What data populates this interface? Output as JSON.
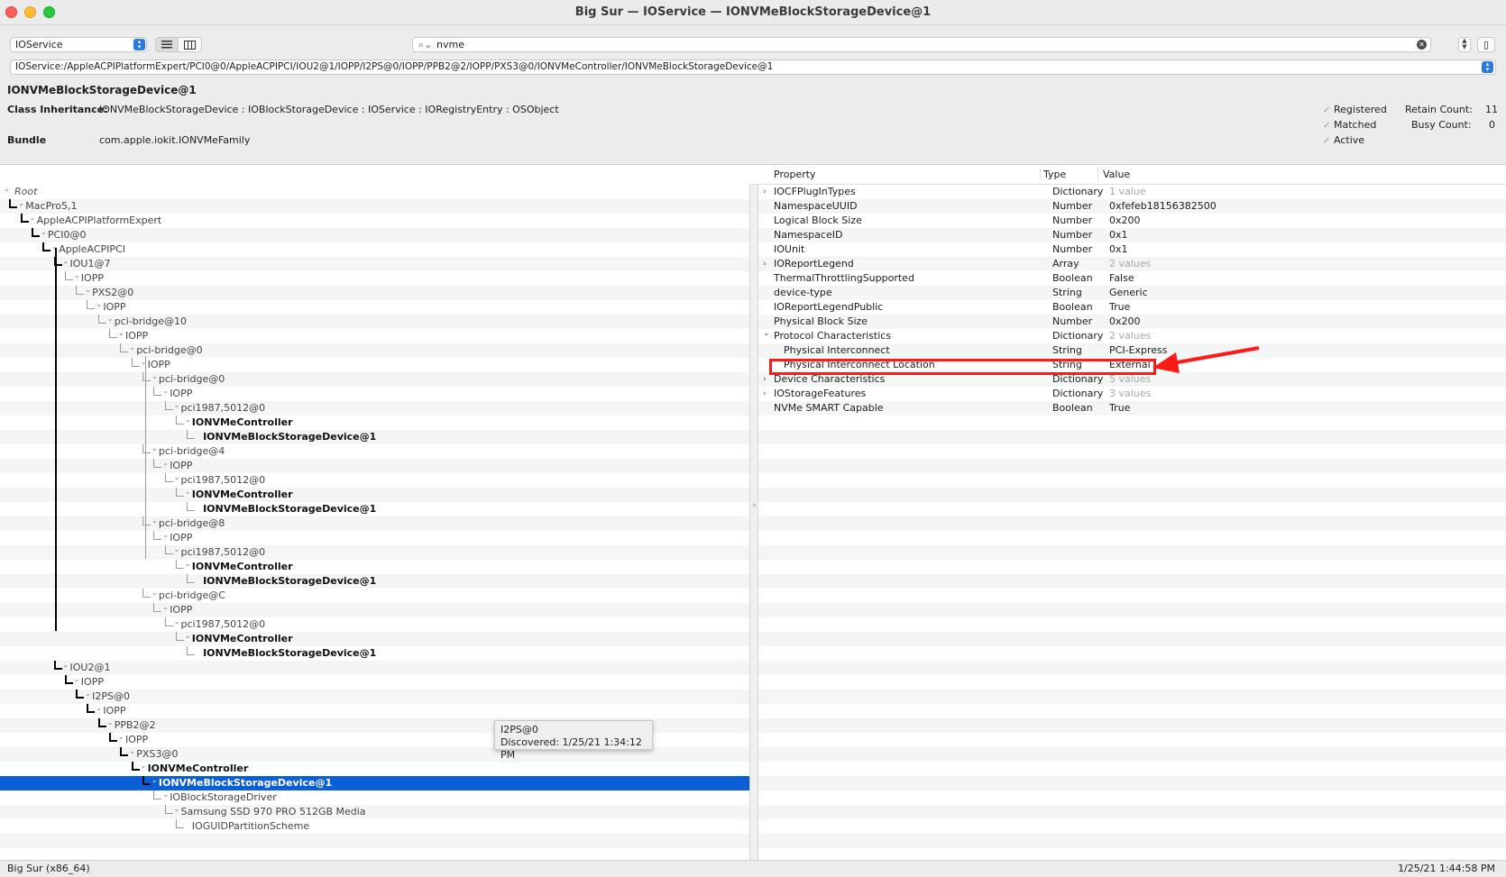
{
  "window": {
    "title": "Big Sur — IOService — IONVMeBlockStorageDevice@1"
  },
  "toolbar": {
    "plane": "IOService",
    "search": "nvme",
    "path": "IOService:/AppleACPIPlatformExpert/PCI0@0/AppleACPIPCI/IOU2@1/IOPP/I2PS@0/IOPP/PPB2@2/IOPP/PXS3@0/IONVMeController/IONVMeBlockStorageDevice@1"
  },
  "object": {
    "title": "IONVMeBlockStorageDevice@1",
    "inheritance_label": "Class Inheritance:",
    "inheritance": "IONVMeBlockStorageDevice : IOBlockStorageDevice : IOService : IORegistryEntry : OSObject",
    "bundle_label": "Bundle",
    "bundle": "com.apple.iokit.IONVMeFamily",
    "registered": "Registered",
    "matched": "Matched",
    "active": "Active",
    "retain_label": "Retain Count:",
    "retain": "11",
    "busy_label": "Busy Count:",
    "busy": "0"
  },
  "props_header": {
    "property": "Property",
    "type": "Type",
    "value": "Value"
  },
  "tree": [
    {
      "label": "Root",
      "style": "i"
    },
    {
      "label": "MacPro5,1",
      "style": "g"
    },
    {
      "label": "AppleACPIPlatformExpert",
      "style": "g"
    },
    {
      "label": "PCI0@0",
      "style": "g"
    },
    {
      "label": "AppleACPIPCI",
      "style": "g"
    },
    {
      "label": "IOU1@7",
      "style": "g"
    },
    {
      "label": "IOPP",
      "style": "g"
    },
    {
      "label": "PXS2@0",
      "style": "g"
    },
    {
      "label": "IOPP",
      "style": "g"
    },
    {
      "label": "pci-bridge@10",
      "style": "g"
    },
    {
      "label": "IOPP",
      "style": "g"
    },
    {
      "label": "pci-bridge@0",
      "style": "g"
    },
    {
      "label": "IOPP",
      "style": "g"
    },
    {
      "label": "pci-bridge@0",
      "style": "g"
    },
    {
      "label": "IOPP",
      "style": "g"
    },
    {
      "label": "pci1987,5012@0",
      "style": "g"
    },
    {
      "label": "IONVMeController",
      "style": "b"
    },
    {
      "label": "IONVMeBlockStorageDevice@1",
      "style": "b"
    },
    {
      "label": "pci-bridge@4",
      "style": "g"
    },
    {
      "label": "IOPP",
      "style": "g"
    },
    {
      "label": "pci1987,5012@0",
      "style": "g"
    },
    {
      "label": "IONVMeController",
      "style": "b"
    },
    {
      "label": "IONVMeBlockStorageDevice@1",
      "style": "b"
    },
    {
      "label": "pci-bridge@8",
      "style": "g"
    },
    {
      "label": "IOPP",
      "style": "g"
    },
    {
      "label": "pci1987,5012@0",
      "style": "g"
    },
    {
      "label": "IONVMeController",
      "style": "b"
    },
    {
      "label": "IONVMeBlockStorageDevice@1",
      "style": "b"
    },
    {
      "label": "pci-bridge@C",
      "style": "g"
    },
    {
      "label": "IOPP",
      "style": "g"
    },
    {
      "label": "pci1987,5012@0",
      "style": "g"
    },
    {
      "label": "IONVMeController",
      "style": "b"
    },
    {
      "label": "IONVMeBlockStorageDevice@1",
      "style": "b"
    },
    {
      "label": "IOU2@1",
      "style": "g"
    },
    {
      "label": "IOPP",
      "style": "g"
    },
    {
      "label": "I2PS@0",
      "style": "g"
    },
    {
      "label": "IOPP",
      "style": "g"
    },
    {
      "label": "PPB2@2",
      "style": "g"
    },
    {
      "label": "IOPP",
      "style": "g"
    },
    {
      "label": "PXS3@0",
      "style": "g"
    },
    {
      "label": "IONVMeController",
      "style": "b"
    },
    {
      "label": "IONVMeBlockStorageDevice@1",
      "style": "b",
      "selected": true
    },
    {
      "label": "IOBlockStorageDriver",
      "style": "g"
    },
    {
      "label": "Samsung SSD 970 PRO 512GB Media",
      "style": "g"
    },
    {
      "label": "IOGUIDPartitionScheme",
      "style": "g"
    }
  ],
  "props": [
    {
      "name": "IOCFPlugInTypes",
      "type": "Dictionary",
      "value": "1 value",
      "dim": true,
      "exp": ">"
    },
    {
      "name": "NamespaceUUID",
      "type": "Number",
      "value": "0xfefeb18156382500"
    },
    {
      "name": "Logical Block Size",
      "type": "Number",
      "value": "0x200"
    },
    {
      "name": "NamespaceID",
      "type": "Number",
      "value": "0x1"
    },
    {
      "name": "IOUnit",
      "type": "Number",
      "value": "0x1"
    },
    {
      "name": "IOReportLegend",
      "type": "Array",
      "value": "2 values",
      "dim": true,
      "exp": ">"
    },
    {
      "name": "ThermalThrottlingSupported",
      "type": "Boolean",
      "value": "False"
    },
    {
      "name": "device-type",
      "type": "String",
      "value": "Generic"
    },
    {
      "name": "IOReportLegendPublic",
      "type": "Boolean",
      "value": "True"
    },
    {
      "name": "Physical Block Size",
      "type": "Number",
      "value": "0x200"
    },
    {
      "name": "Protocol Characteristics",
      "type": "Dictionary",
      "value": "2 values",
      "dim": true,
      "exp": "v"
    },
    {
      "name": "Physical Interconnect",
      "type": "String",
      "value": "PCI-Express",
      "child": true
    },
    {
      "name": "Physical Interconnect Location",
      "type": "String",
      "value": "External",
      "child": true
    },
    {
      "name": "Device Characteristics",
      "type": "Dictionary",
      "value": "5 values",
      "dim": true,
      "exp": ">"
    },
    {
      "name": "IOStorageFeatures",
      "type": "Dictionary",
      "value": "3 values",
      "dim": true,
      "exp": ">"
    },
    {
      "name": "NVMe SMART Capable",
      "type": "Boolean",
      "value": "True"
    }
  ],
  "tooltip": {
    "line1": "I2PS@0",
    "line2": "Discovered: 1/25/21 1:34:12 PM"
  },
  "status": {
    "left": "Big Sur (x86_64)",
    "right": "1/25/21 1:44:58 PM"
  },
  "colors": {
    "selection": "#0a5fd7",
    "highlight": "#ff1a1a"
  }
}
